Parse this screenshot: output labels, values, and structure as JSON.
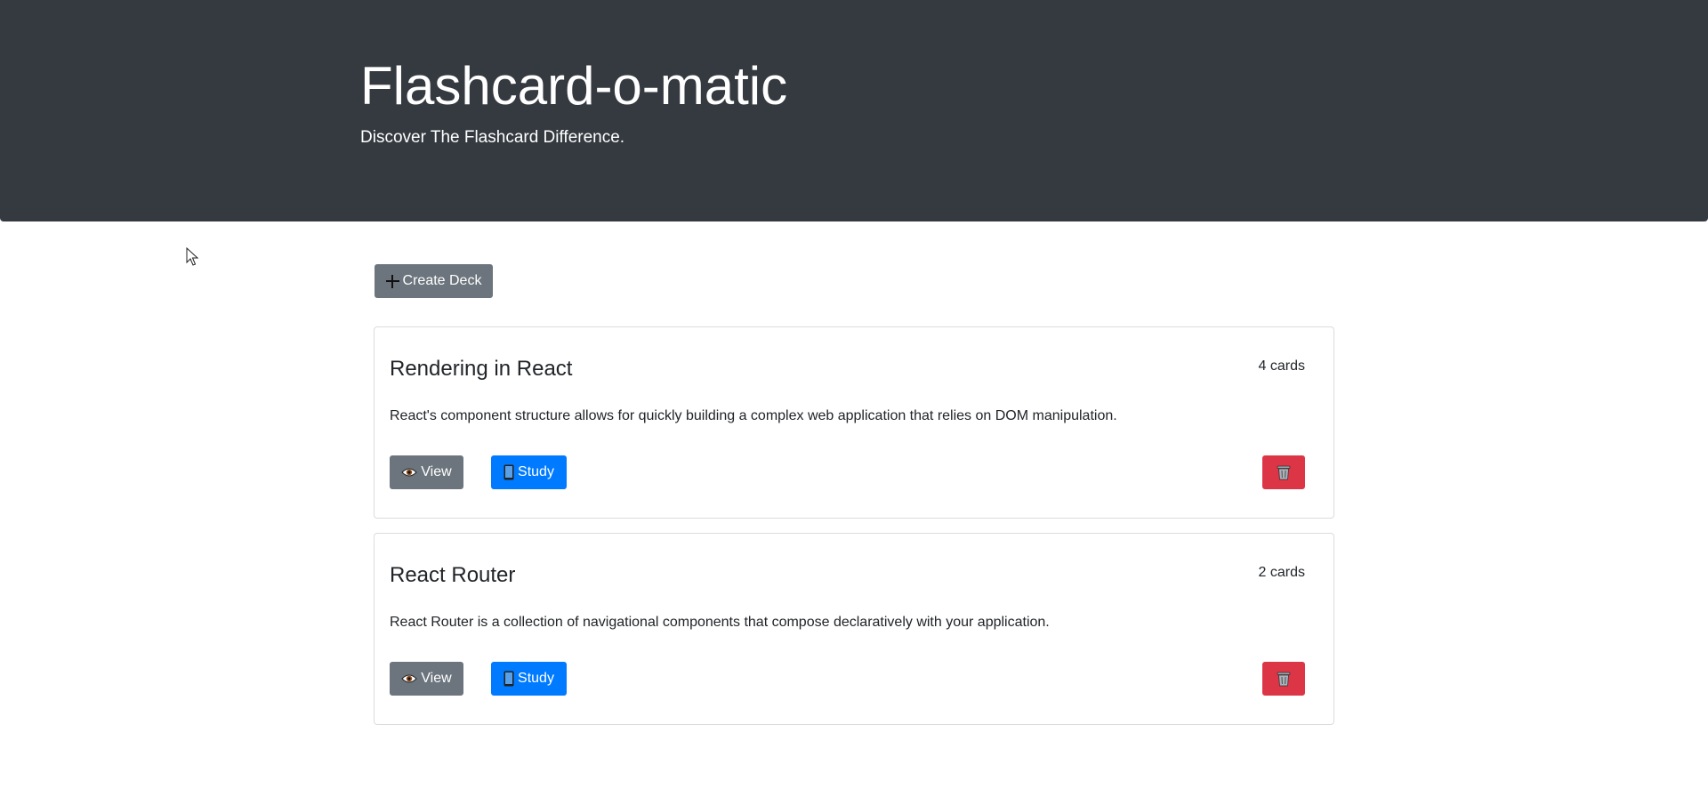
{
  "header": {
    "title": "Flashcard-o-matic",
    "subtitle": "Discover The Flashcard Difference."
  },
  "toolbar": {
    "create_label": "Create Deck",
    "create_icon": "plus-icon"
  },
  "decks": [
    {
      "name": "Rendering in React",
      "count": "4 cards",
      "description": "React's component structure allows for quickly building a complex web application that relies on DOM manipulation.",
      "view_label": "View",
      "study_label": "Study"
    },
    {
      "name": "React Router",
      "count": "2 cards",
      "description": "React Router is a collection of navigational components that compose declaratively with your application.",
      "view_label": "View",
      "study_label": "Study"
    }
  ],
  "colors": {
    "header_bg": "#343a40",
    "secondary": "#6c757d",
    "primary": "#007bff",
    "danger": "#dc3545"
  }
}
